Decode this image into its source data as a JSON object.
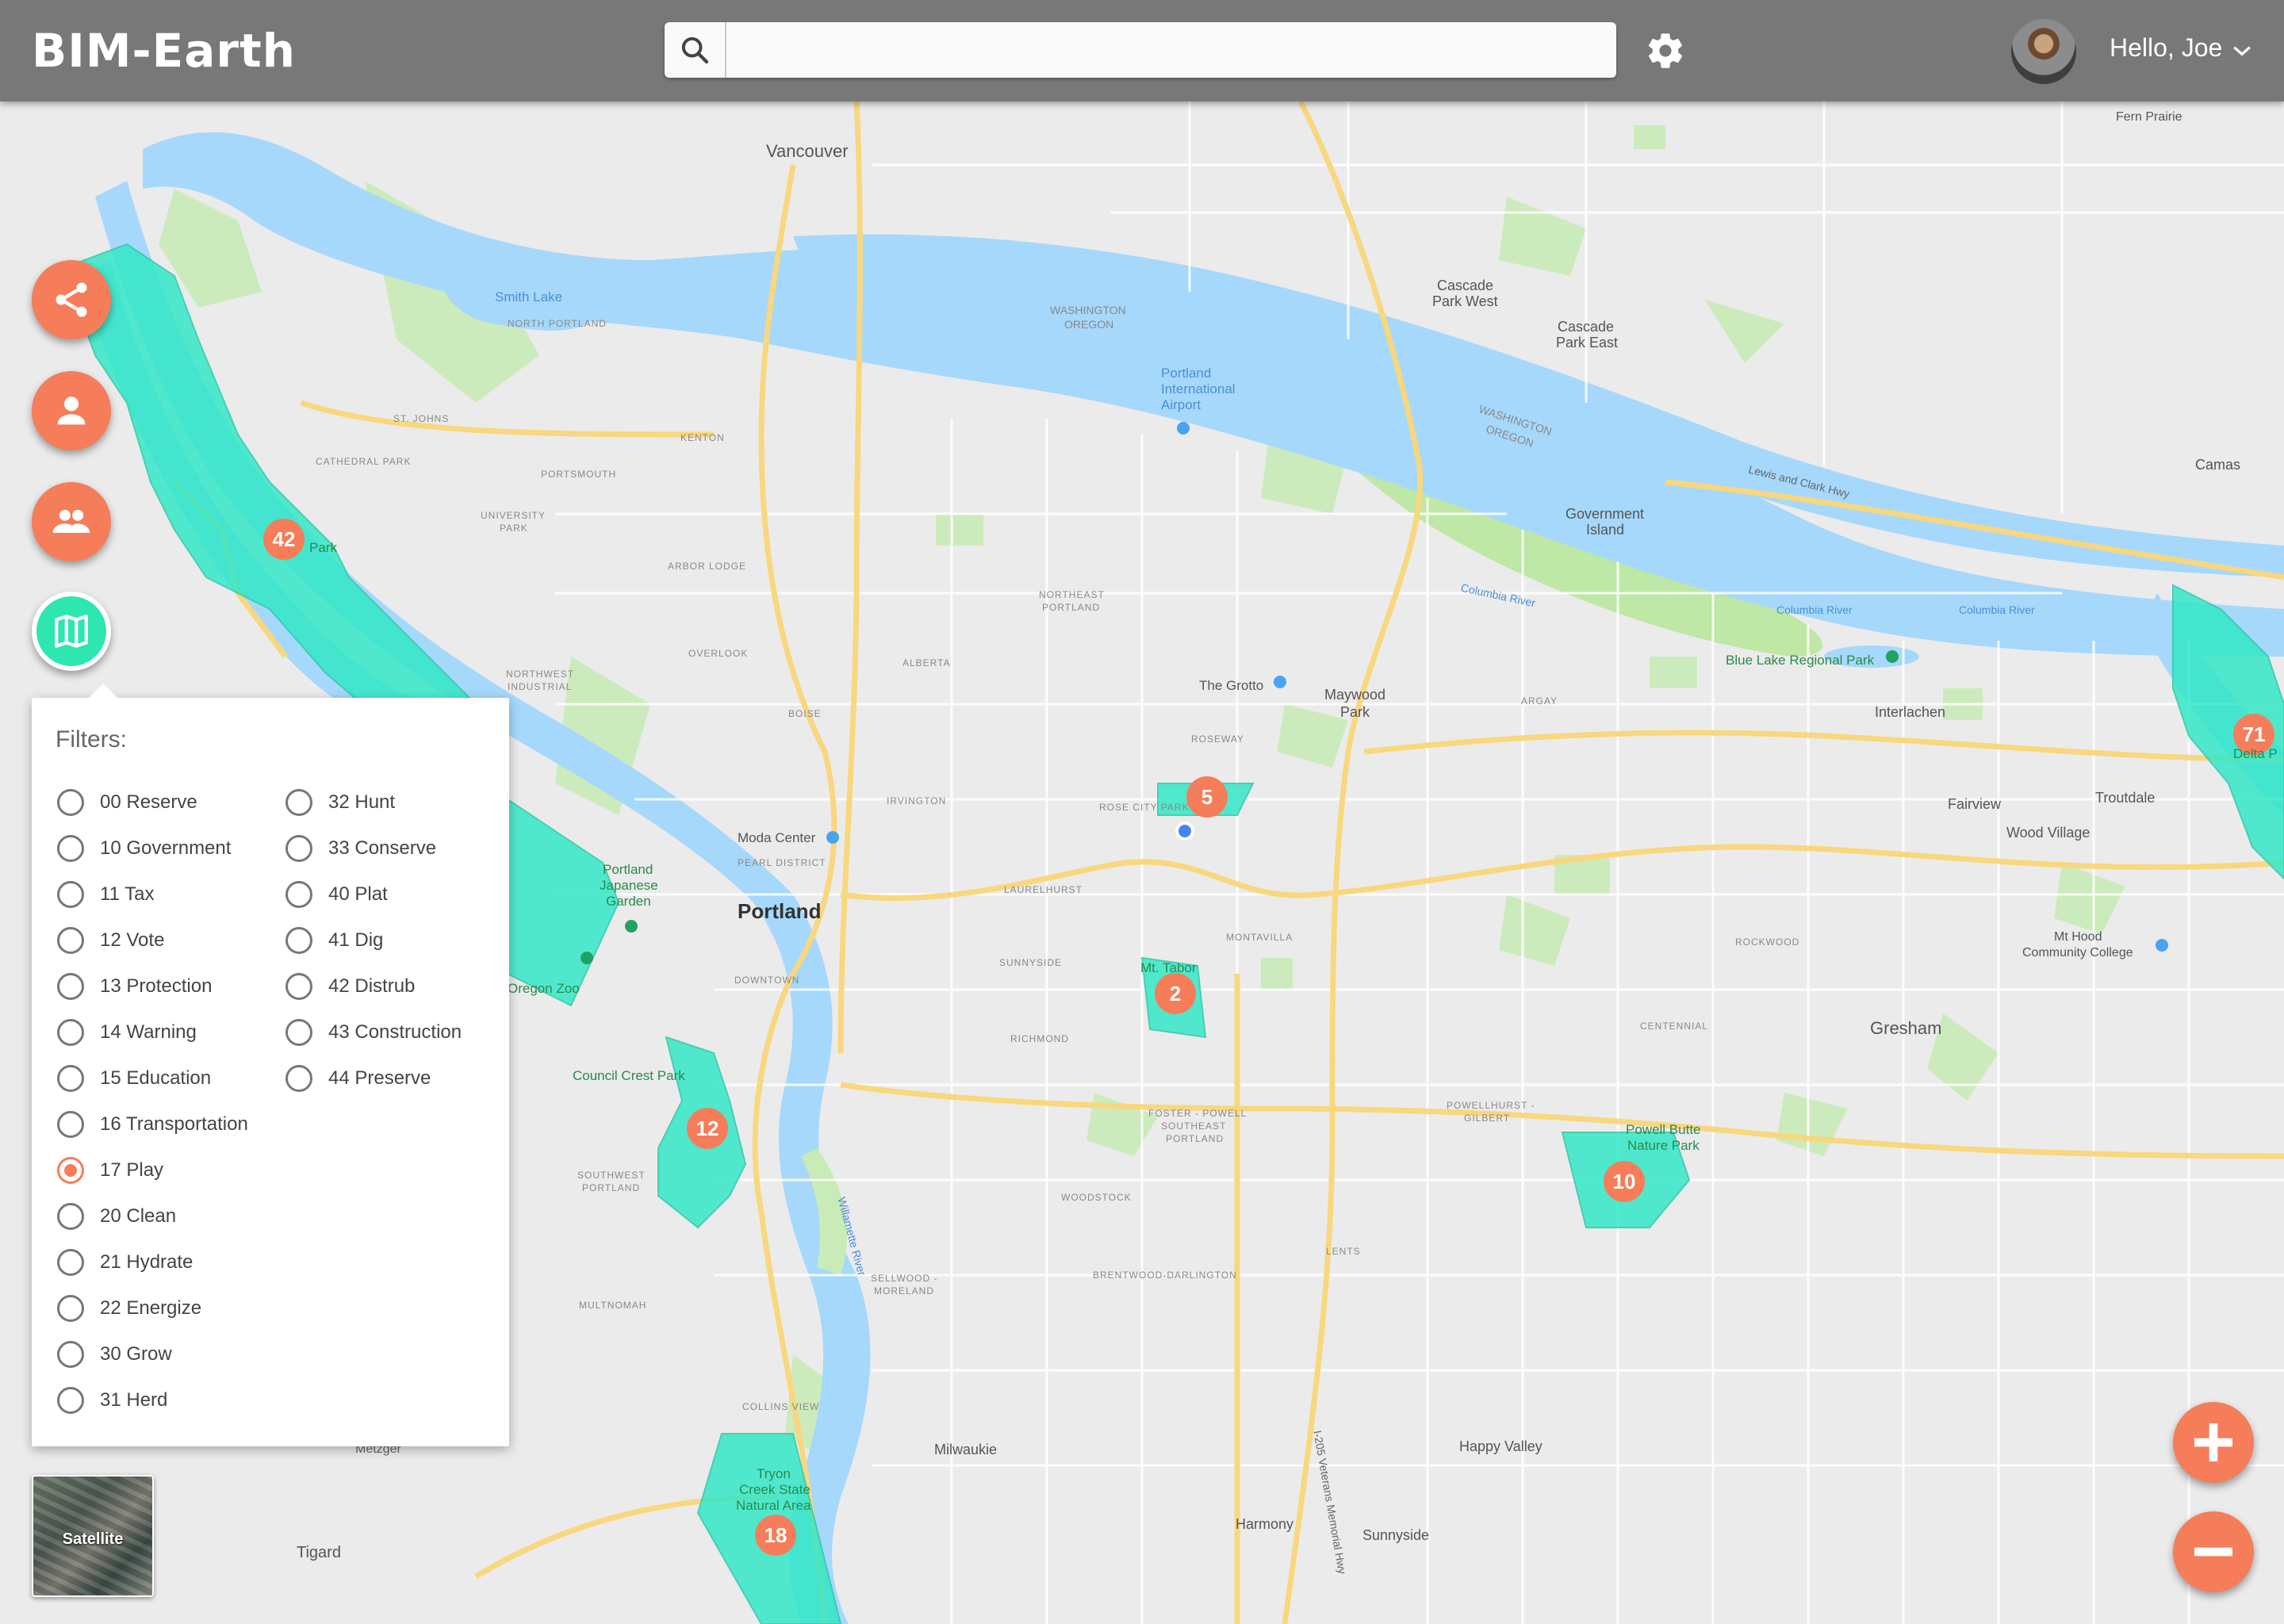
{
  "header": {
    "app_title": "BIM-Earth",
    "search_placeholder": "",
    "greeting": "Hello, Joe"
  },
  "colors": {
    "header_bg": "#787878",
    "accent": "#f57d59",
    "parcel": "#2ee6b0",
    "water": "#a6d8fb",
    "park": "#c4e9b0",
    "road": "#f8d77e"
  },
  "fabs": [
    {
      "name": "share-fab",
      "icon": "share-icon"
    },
    {
      "name": "person-fab",
      "icon": "person-icon"
    },
    {
      "name": "group-fab",
      "icon": "group-icon"
    },
    {
      "name": "map-layers-fab",
      "icon": "map-icon"
    }
  ],
  "filters": {
    "title": "Filters:",
    "selected": "17 Play",
    "options_col1": [
      "00 Reserve",
      "10 Government",
      "11 Tax",
      "12 Vote",
      "13 Protection",
      "14 Warning",
      "15 Education",
      "16 Transportation",
      "17 Play",
      "20 Clean",
      "21 Hydrate",
      "22 Energize",
      "30 Grow",
      "31 Herd"
    ],
    "options_col2": [
      "32 Hunt",
      "33 Conserve",
      "40 Plat",
      "41 Dig",
      "42 Distrub",
      "43 Construction",
      "44 Preserve"
    ]
  },
  "map": {
    "satellite_label": "Satellite",
    "markers": [
      "42",
      "5",
      "2",
      "12",
      "10",
      "18",
      "71"
    ],
    "places": {
      "vancouver": "Vancouver",
      "portland": "Portland",
      "gresham": "Gresham",
      "milwaukie": "Milwaukie",
      "happy_valley": "Happy Valley",
      "fairview": "Fairview",
      "troutdale": "Troutdale",
      "wood_village": "Wood Village",
      "camas": "Camas",
      "tigard": "Tigard",
      "harmony": "Harmony",
      "sunnyside": "Sunnyside",
      "maywood_park_1": "Maywood",
      "maywood_park_2": "Park",
      "interlachen": "Interlachen",
      "cascade_park_west_1": "Cascade",
      "cascade_park_west_2": "Park West",
      "cascade_park_east_1": "Cascade",
      "cascade_park_east_2": "Park East",
      "government_island_1": "Government",
      "government_island_2": "Island",
      "portland_airport_1": "Portland",
      "portland_airport_2": "International",
      "portland_airport_3": "Airport",
      "the_grotto": "The Grotto",
      "blue_lake": "Blue Lake Regional Park",
      "moda_center": "Moda Center",
      "japanese_garden_1": "Portland",
      "japanese_garden_2": "Japanese",
      "japanese_garden_3": "Garden",
      "oregon_zoo": "Oregon Zoo",
      "council_crest": "Council Crest Park",
      "mt_tabor": "Mt. Tabor",
      "powell_butte_1": "Powell Butte",
      "powell_butte_2": "Nature Park",
      "tryon_1": "Tryon",
      "tryon_2": "Creek State",
      "tryon_3": "Natural Area",
      "mt_hood_cc_1": "Mt Hood",
      "mt_hood_cc_2": "Community College",
      "smith_lake": "Smith Lake",
      "fern_prairie": "Fern Prairie",
      "forest_park": "Park",
      "columbia_river_1": "Columbia River",
      "columbia_river_2": "Columbia River",
      "columbia_river_3": "Columbia River",
      "willamette_river": "Willamette River",
      "washington_1": "WASHINGTON",
      "oregon_1": "OREGON",
      "washington_2": "WASHINGTON",
      "oregon_2": "OREGON",
      "lewis_clark": "Lewis and Clark Hwy",
      "delta_park": "Delta P",
      "hwy_205_label": "I-205 Veterans Memorial Hwy"
    },
    "neighborhoods": {
      "st_johns": "ST. JOHNS",
      "cathedral_park": "CATHEDRAL PARK",
      "portsmouth": "PORTSMOUTH",
      "kenton": "KENTON",
      "university_park_1": "UNIVERSITY",
      "university_park_2": "PARK",
      "arbor_lodge": "ARBOR LODGE",
      "overlook": "OVERLOOK",
      "northwest_industrial_1": "NORTHWEST",
      "northwest_industrial_2": "INDUSTRIAL",
      "alberta": "ALBERTA",
      "boise": "BOISE",
      "irvington": "IRVINGTON",
      "pearl_district": "PEARL DISTRICT",
      "downtown": "DOWNTOWN",
      "laurelhurst": "LAURELHURST",
      "rose_city_park": "ROSE CITY PARK",
      "roseway": "ROSEWAY",
      "montavilla": "MONTAVILLA",
      "sunnyside_nb": "SUNNYSIDE",
      "richmond": "RICHMOND",
      "foster_powell": "FOSTER - POWELL",
      "southeast_portland_1": "SOUTHEAST",
      "southeast_portland_2": "PORTLAND",
      "woodstock": "WOODSTOCK",
      "brentwood_darlington": "BRENTWOOD-DARLINGTON",
      "sellwood_1": "SELLWOOD -",
      "sellwood_2": "MORELAND",
      "multnomah": "MULTNOMAH",
      "southwest_portland_1": "SOUTHWEST",
      "southwest_portland_2": "PORTLAND",
      "collins_view": "COLLINS VIEW",
      "centennial": "CENTENNIAL",
      "rockwood": "ROCKWOOD",
      "argay": "ARGAY",
      "northeast_portland_1": "NORTHEAST",
      "northeast_portland_2": "PORTLAND",
      "powellhurst_1": "POWELLHURST -",
      "powellhurst_2": "GILBERT",
      "north_portland": "NORTH PORTLAND",
      "lents": "LENTS",
      "metzger": "Metzger"
    }
  }
}
